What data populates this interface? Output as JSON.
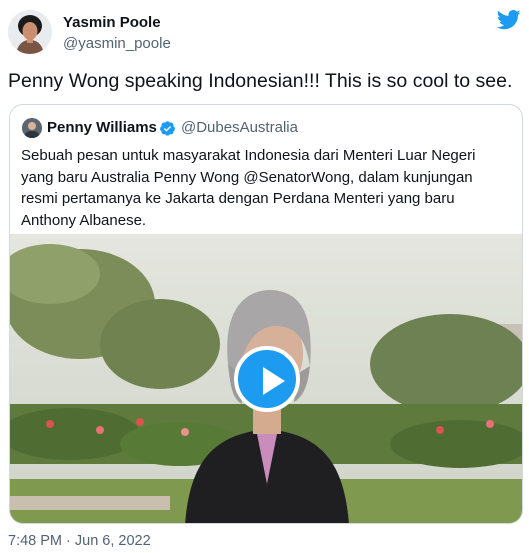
{
  "tweet": {
    "author_name": "Yasmin Poole",
    "author_handle": "@yasmin_poole",
    "text": "Penny Wong speaking Indonesian!!! This is so cool to see.",
    "timestamp": "7:48 PM · Jun 6, 2022",
    "brand_icon": "twitter-bird-icon",
    "brand_color": "#1d9bf0"
  },
  "quoted_tweet": {
    "author_name": "Penny Williams",
    "author_handle": "@DubesAustralia",
    "verified": true,
    "text": "Sebuah pesan untuk masyarakat Indonesia dari Menteri Luar Negeri yang baru Australia Penny Wong @SenatorWong, dalam kunjungan resmi pertamanya ke Jakarta dengan Perdana Menteri yang baru Anthony Albanese.",
    "media": {
      "type": "video",
      "play_icon": "play-icon"
    }
  }
}
